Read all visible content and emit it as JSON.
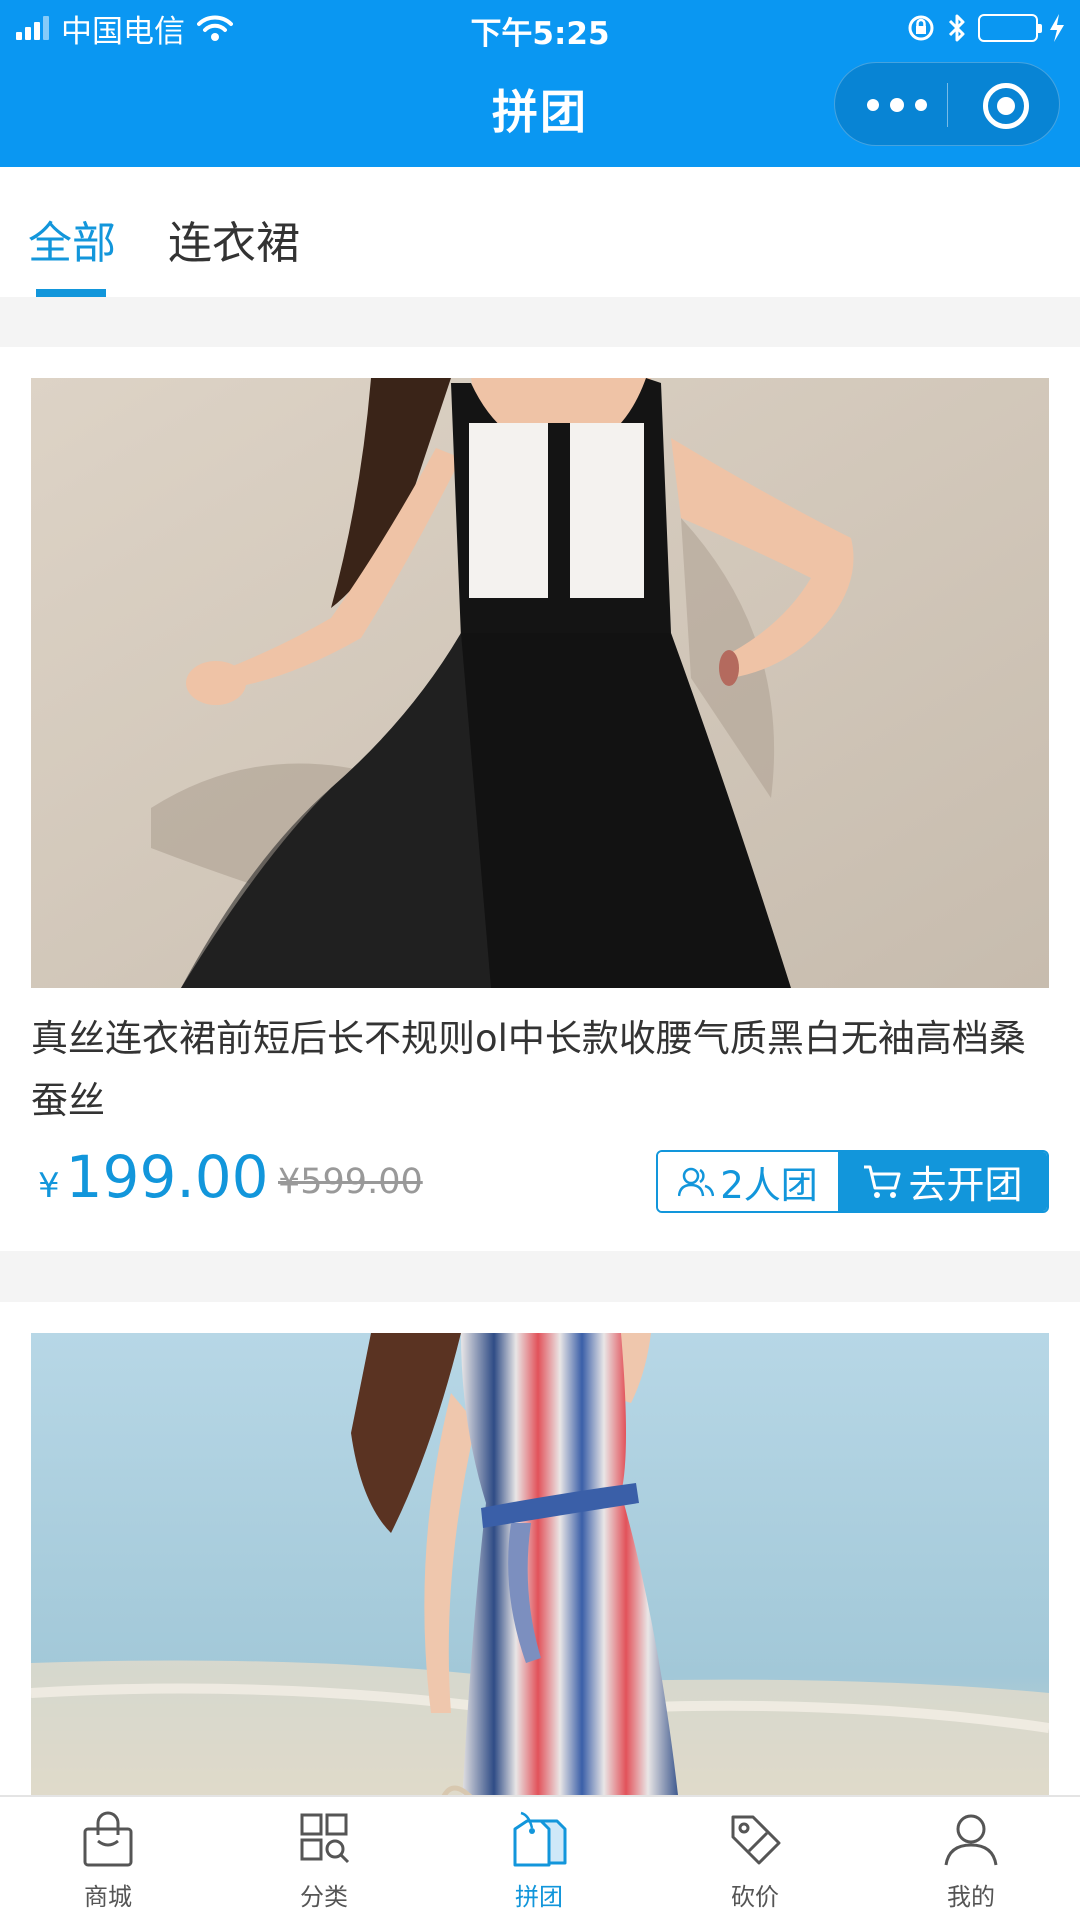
{
  "status_bar": {
    "carrier": "中国电信",
    "time": "下午5:25"
  },
  "header": {
    "title": "拼团"
  },
  "tabs": [
    {
      "label": "全部",
      "active": true
    },
    {
      "label": "连衣裙",
      "active": false
    }
  ],
  "products": [
    {
      "name": "真丝连衣裙前短后长不规则ol中长款收腰气质黑白无袖高档桑蚕丝",
      "currency": "¥",
      "price": "199.00",
      "original_price": "¥599.00",
      "group_size_label": "2人团",
      "action_label": "去开团"
    }
  ],
  "bottom_nav": [
    {
      "label": "商城",
      "icon": "bag-icon"
    },
    {
      "label": "分类",
      "icon": "grid-search-icon"
    },
    {
      "label": "拼团",
      "icon": "price-tag-icon",
      "active": true
    },
    {
      "label": "砍价",
      "icon": "discount-tag-icon"
    },
    {
      "label": "我的",
      "icon": "user-icon"
    }
  ],
  "colors": {
    "brand": "#0a97f2",
    "accent": "#1296db",
    "battery": "#4cd964"
  }
}
